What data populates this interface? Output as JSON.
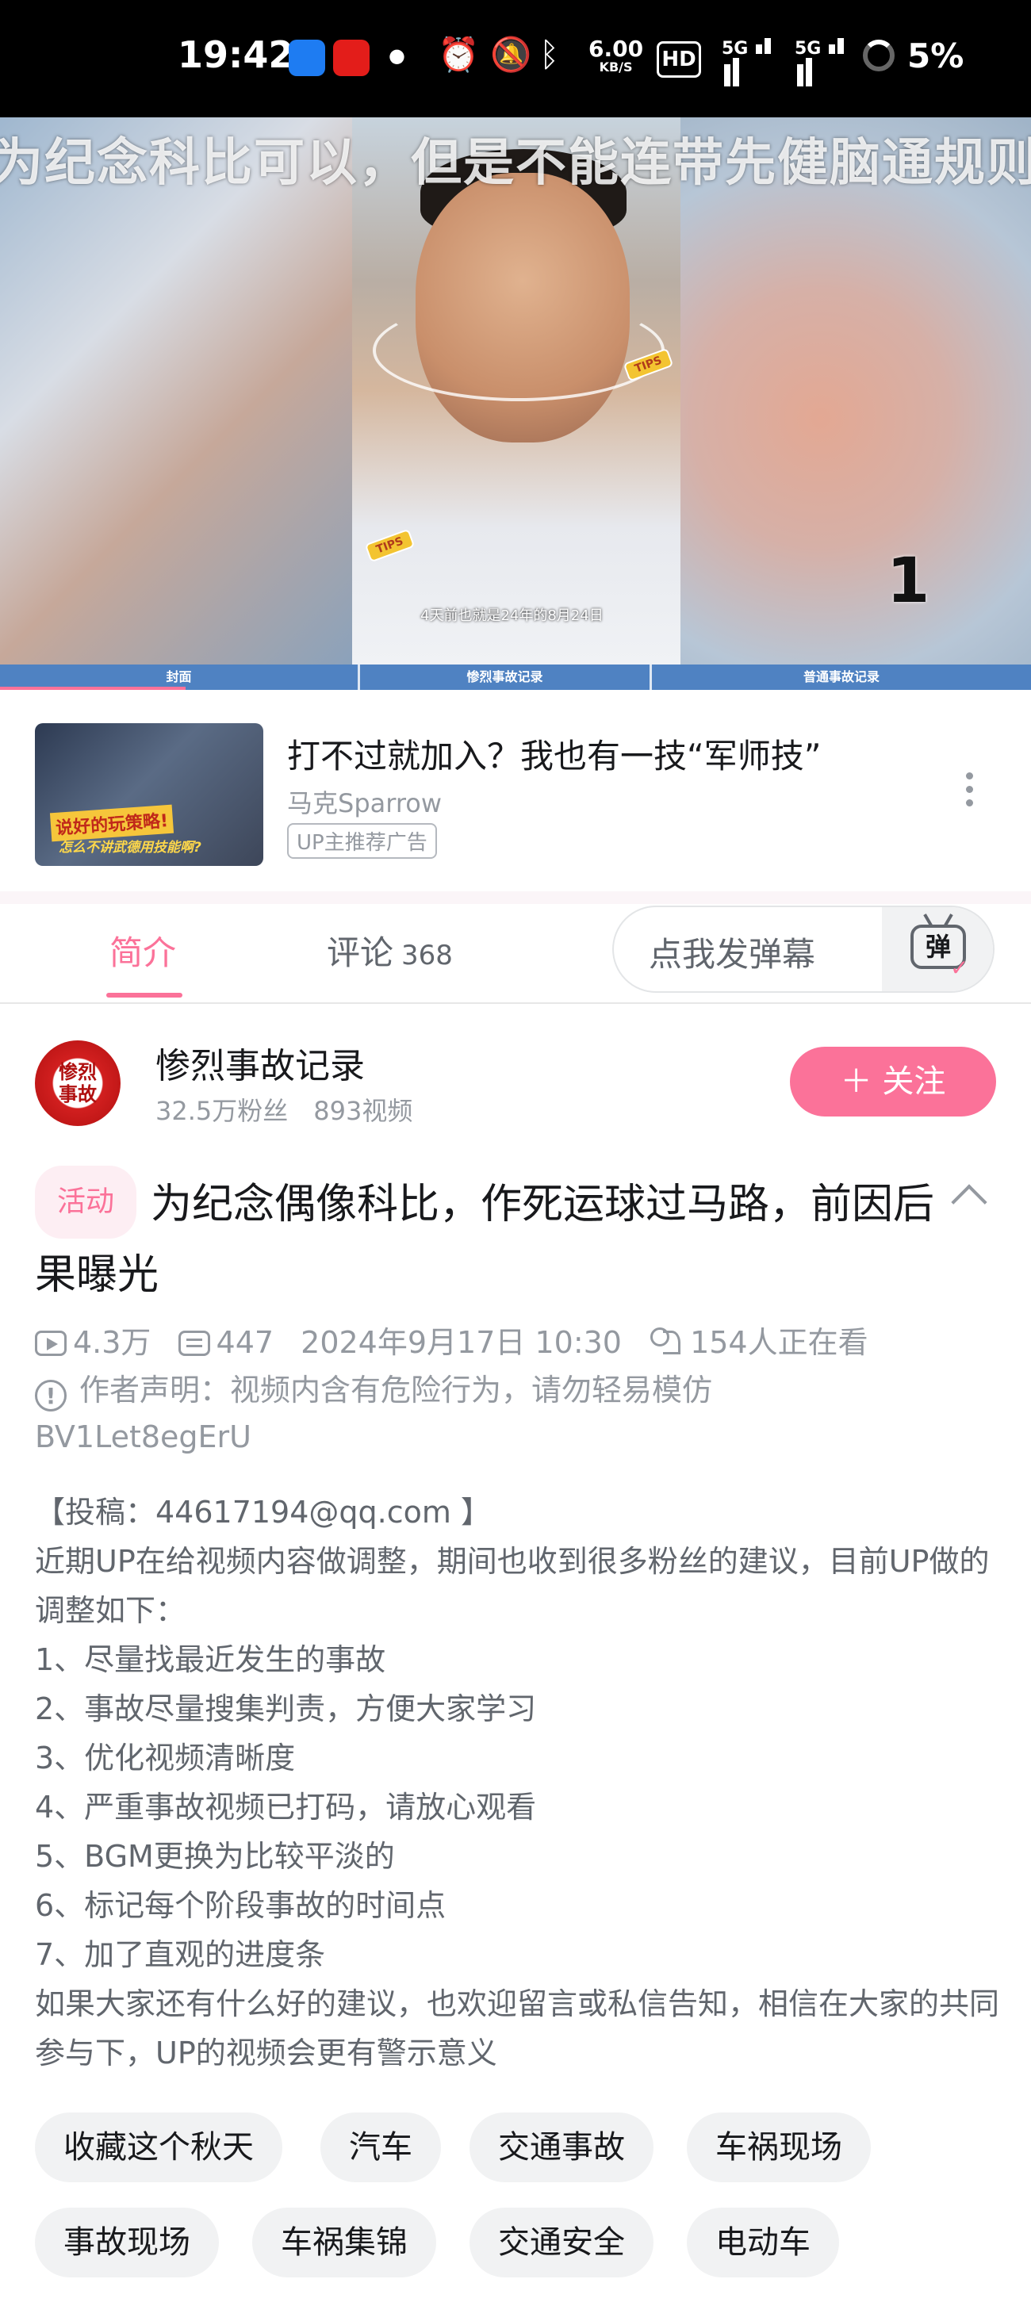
{
  "status_bar": {
    "time": "19:42",
    "net_speed_value": "6.00",
    "net_speed_unit": "KB/S",
    "hd_label": "HD",
    "sim1_label": "5G",
    "sim2_label": "5G",
    "battery": "5%"
  },
  "video": {
    "danmaku_text": "为纪念科比可以，但是不能连带先健脑通规则",
    "subtitle": "4天前也就是24年的8月24日",
    "tip_tag": "TIPS",
    "counter": "1",
    "chapters": [
      "封面",
      "惨烈事故记录",
      "普通事故记录"
    ],
    "progress": 0.18
  },
  "ad": {
    "thumb_line1": "说好的玩策略!",
    "thumb_line2": "怎么不讲武德用技能啊?",
    "title": "打不过就加入？我也有一技“军师技”",
    "author": "马克Sparrow",
    "badge": "UP主推荐广告"
  },
  "tabs": {
    "intro": "简介",
    "comments": "评论",
    "comments_count": "368",
    "danmu_placeholder": "点我发弹幕",
    "danmu_button": "弹"
  },
  "uploader": {
    "avatar_text": "惨烈事故",
    "name": "惨烈事故记录",
    "fans": "32.5万粉丝",
    "videos": "893视频",
    "follow_label": "＋ 关注"
  },
  "info": {
    "activity_tag": "活动",
    "title": "为纪念偶像科比，作死运球过马路，前因后果曝光",
    "views": "4.3万",
    "danmaku_count": "447",
    "date": "2024年9月17日 10:30",
    "watching": "154人正在看",
    "notice": "作者声明：视频内含有危险行为，请勿轻易模仿",
    "bvid": "BV1Let8egErU"
  },
  "description": [
    "【投稿：44617194@qq.com 】",
    "近期UP在给视频内容做调整，期间也收到很多粉丝的建议，目前UP做的调整如下：",
    "1、尽量找最近发生的事故",
    "2、事故尽量搜集判责，方便大家学习",
    "3、优化视频清晰度",
    "4、严重事故视频已打码，请放心观看",
    "5、BGM更换为比较平淡的",
    "6、标记每个阶段事故的时间点",
    "7、加了直观的进度条",
    "如果大家还有什么好的建议，也欢迎留言或私信告知，相信在大家的共同参与下，UP的视频会更有警示意义"
  ],
  "tags": [
    "收藏这个秋天",
    "汽车",
    "交通事故",
    "车祸现场",
    "事故现场",
    "车祸集锦",
    "交通安全",
    "电动车"
  ],
  "colors": {
    "accent": "#fb7299",
    "text_primary": "#18191c",
    "text_secondary": "#9499a0",
    "tag_bg": "#f1f2f3"
  }
}
